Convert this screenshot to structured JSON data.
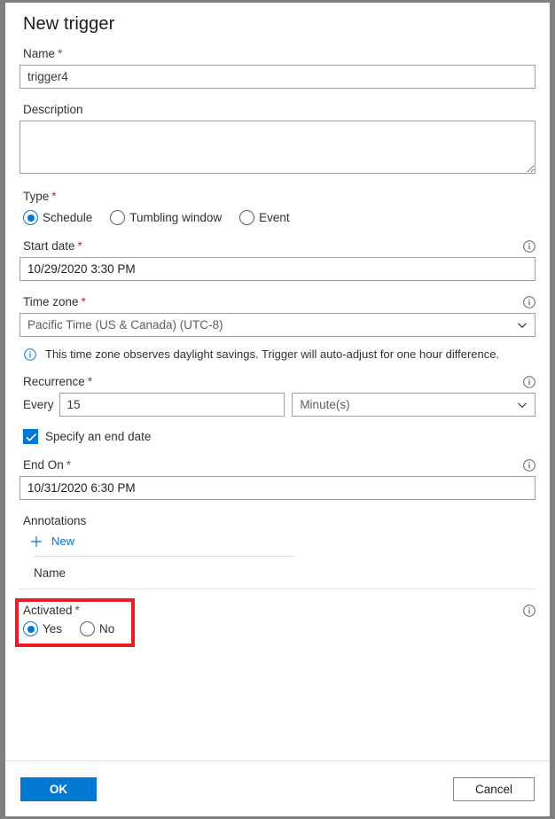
{
  "dialog": {
    "title": "New trigger"
  },
  "fields": {
    "name": {
      "label": "Name",
      "required": "*",
      "value": "trigger4"
    },
    "description": {
      "label": "Description",
      "value": ""
    },
    "type": {
      "label": "Type",
      "required": "*",
      "options": [
        {
          "label": "Schedule",
          "selected": true
        },
        {
          "label": "Tumbling window",
          "selected": false
        },
        {
          "label": "Event",
          "selected": false
        }
      ]
    },
    "start_date": {
      "label": "Start date",
      "required": "*",
      "value": "10/29/2020 3:30 PM",
      "info_icon": "info-icon"
    },
    "time_zone": {
      "label": "Time zone",
      "required": "*",
      "value": "Pacific Time (US & Canada) (UTC-8)",
      "chevron_icon": "chevron-down-icon",
      "info_icon": "info-icon",
      "note": "This time zone observes daylight savings. Trigger will auto-adjust for one hour difference.",
      "note_icon": "info-icon"
    },
    "recurrence": {
      "label": "Recurrence",
      "required": "*",
      "every_label": "Every",
      "interval": "15",
      "unit": "Minute(s)",
      "chevron_icon": "chevron-down-icon",
      "info_icon": "info-icon"
    },
    "specify_end_date": {
      "label": "Specify an end date",
      "checked": true,
      "check_icon": "checkmark-icon"
    },
    "end_on": {
      "label": "End On",
      "required": "*",
      "value": "10/31/2020 6:30 PM",
      "info_icon": "info-icon"
    },
    "annotations": {
      "label": "Annotations",
      "new_label": "New",
      "plus_icon": "plus-icon",
      "column_header": "Name",
      "rows": []
    },
    "activated": {
      "label": "Activated",
      "required": "*",
      "info_icon": "info-icon",
      "options": [
        {
          "label": "Yes",
          "selected": true
        },
        {
          "label": "No",
          "selected": false
        }
      ]
    }
  },
  "footer": {
    "ok_label": "OK",
    "cancel_label": "Cancel"
  },
  "colors": {
    "accent": "#0078d4",
    "required": "#a4373a",
    "highlight": "#ec1c24",
    "border": "#a19f9d",
    "frame": "#808080"
  }
}
